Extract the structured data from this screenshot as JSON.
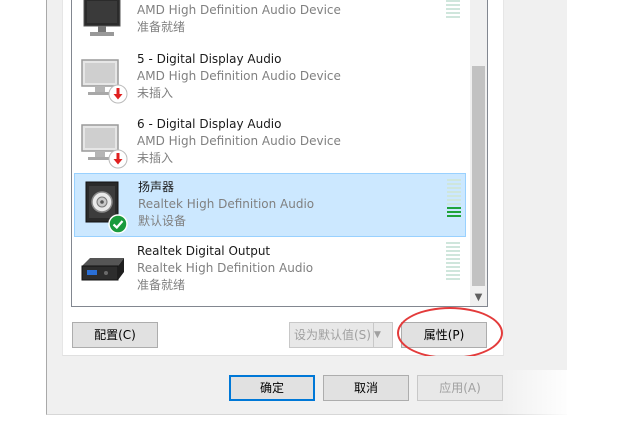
{
  "devices": [
    {
      "name": "",
      "driver": "AMD High Definition Audio Device",
      "status": "准备就绪",
      "icon": "monitor-icon",
      "badge": "",
      "selected": false,
      "level": 0
    },
    {
      "name": "5 - Digital Display Audio",
      "driver": "AMD High Definition Audio Device",
      "status": "未插入",
      "icon": "monitor-icon",
      "badge": "unplugged-arrow-icon",
      "selected": false
    },
    {
      "name": "6 - Digital Display Audio",
      "driver": "AMD High Definition Audio Device",
      "status": "未插入",
      "icon": "monitor-icon",
      "badge": "unplugged-arrow-icon",
      "selected": false
    },
    {
      "name": "扬声器",
      "driver": "Realtek High Definition Audio",
      "status": "默认设备",
      "icon": "speaker-icon",
      "badge": "default-check-icon",
      "selected": true,
      "level": 0.3
    },
    {
      "name": "Realtek Digital Output",
      "driver": "Realtek High Definition Audio",
      "status": "准备就绪",
      "icon": "digital-output-icon",
      "badge": "",
      "selected": false,
      "level": 0
    }
  ],
  "buttons": {
    "configure": "配置(C)",
    "set_default": "设为默认值(S)",
    "properties": "属性(P)",
    "ok": "确定",
    "cancel": "取消",
    "apply": "应用(A)"
  },
  "colors": {
    "selection": "#cce8ff",
    "level_on": "#1fa33a",
    "annotation": "#e33b3b",
    "unplugged_badge": "#e02020",
    "default_badge": "#1a9b3c"
  }
}
